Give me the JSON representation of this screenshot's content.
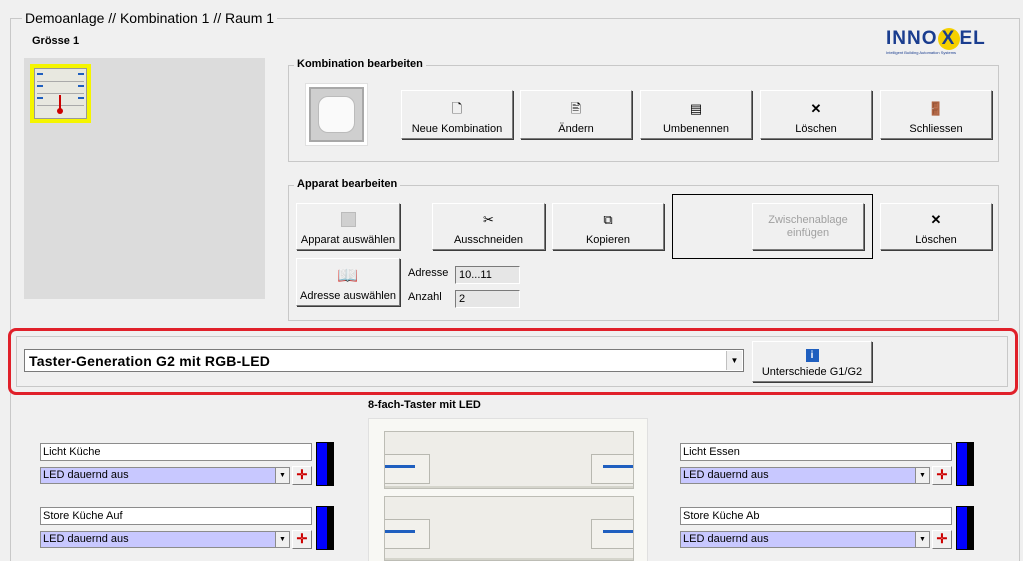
{
  "window": {
    "title": "Demoanlage // Kombination 1 // Raum 1",
    "size_label": "Grösse 1"
  },
  "logo": {
    "text_left": "INNO",
    "text_x": "X",
    "text_right": "EL",
    "tagline": "Intelligent Building Automation Systems"
  },
  "kombination": {
    "title": "Kombination bearbeiten",
    "buttons": {
      "new": "Neue Kombination",
      "edit": "Ändern",
      "rename": "Umbenennen",
      "delete": "Löschen",
      "close": "Schliessen"
    }
  },
  "apparat": {
    "title": "Apparat bearbeiten",
    "buttons": {
      "select": "Apparat auswählen",
      "cut": "Ausschneiden",
      "copy": "Kopieren",
      "paste": "Zwischenablage einfügen",
      "delete": "Löschen",
      "address_select": "Adresse auswählen"
    },
    "address_label": "Adresse",
    "address_value": "10...11",
    "count_label": "Anzahl",
    "count_value": "2"
  },
  "generation": {
    "selected": "Taster-Generation G2 mit RGB-LED",
    "diff_button": "Unterschiede G1/G2"
  },
  "taster": {
    "title": "8-fach-Taster mit LED",
    "left": [
      {
        "name": "Licht Küche",
        "led": "LED dauernd aus"
      },
      {
        "name": "Store Küche Auf",
        "led": "LED dauernd aus"
      }
    ],
    "right": [
      {
        "name": "Licht Essen",
        "led": "LED dauernd aus"
      },
      {
        "name": "Store Küche Ab",
        "led": "LED dauernd aus"
      }
    ]
  },
  "colors": {
    "highlight_border": "#e0202a",
    "led_blue": "#0000ff",
    "led_combo_bg": "#c8c8ff",
    "logo_blue": "#1a3d8f",
    "logo_yellow": "#f5d000"
  }
}
